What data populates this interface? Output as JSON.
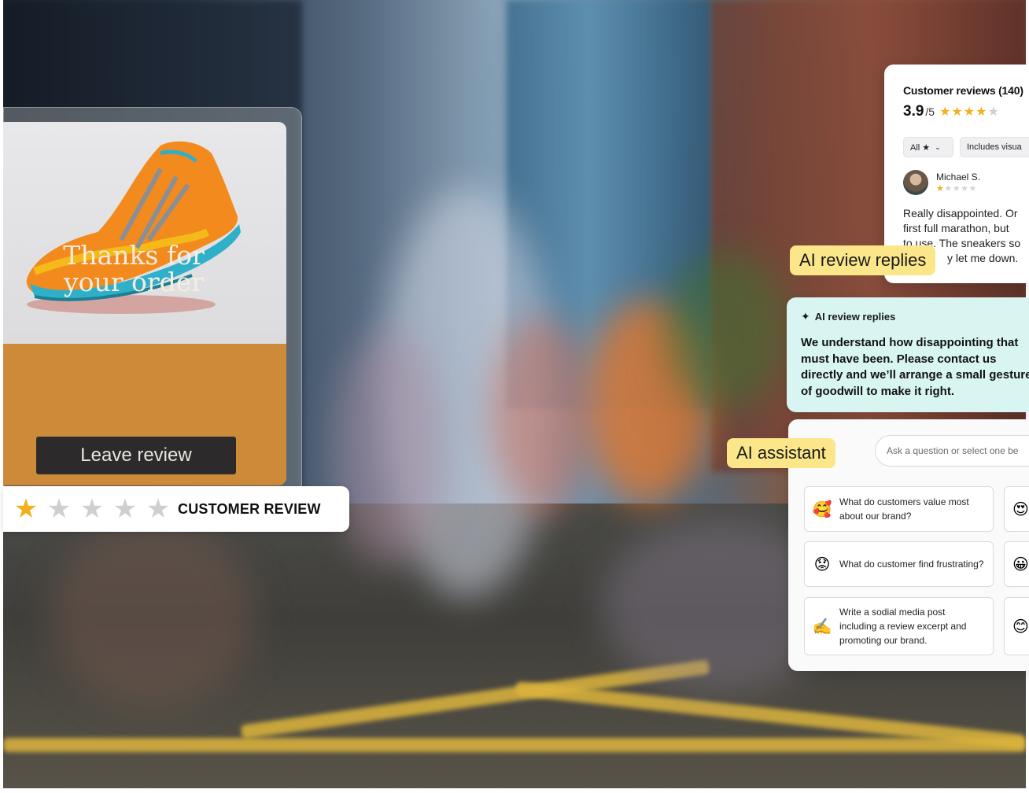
{
  "product_card": {
    "thanks_line1": "Thanks for",
    "thanks_line2": "your order",
    "leave_review_label": "Leave review"
  },
  "review_strip": {
    "rating": 1,
    "max": 5,
    "label": "CUSTOMER REVIEW"
  },
  "reviews_panel": {
    "title": "Customer reviews (140)",
    "rating_value": "3.9",
    "rating_max": "/5",
    "stars_filled": 4,
    "filters": [
      "All ★",
      "Includes visua"
    ],
    "reviewer_name": "Michael S.",
    "reviewer_stars": 1,
    "review_line1": "Really disappointed. Or",
    "review_line2": "first full marathon, but",
    "review_line3": "to use. The sneakers so",
    "review_line4": "y let me down."
  },
  "tags": {
    "ai_review_replies": "AI review replies",
    "ai_assistant": "AI assistant"
  },
  "reply_panel": {
    "header": "AI review replies",
    "icon": "sparkle-icon",
    "text": "We understand how disappointing that must have been. Please contact us directly and we’ll arrange a small gesture of goodwill to make it right."
  },
  "assistant": {
    "placeholder": "Ask a question or select one be",
    "suggestions": [
      {
        "emoji": "🥰",
        "text": "What do customers value most about our brand?"
      },
      {
        "emoji": "😟",
        "text": "What do customer find frustrating?"
      },
      {
        "emoji": "✍️",
        "text": "Write a sodial media post including a review excerpt and promoting our brand."
      }
    ],
    "side_emojis": [
      "😍",
      "😀",
      "😊"
    ]
  },
  "colors": {
    "tag_yellow": "#fbe68a",
    "reply_teal": "#d9f5f2",
    "star_gold": "#f2b01e",
    "product_orange": "#cd8b3a"
  }
}
